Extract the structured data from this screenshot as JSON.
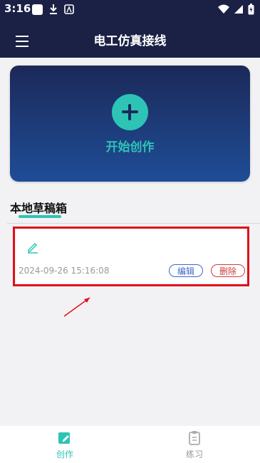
{
  "status": {
    "time": "3:16"
  },
  "appbar": {
    "title": "电工仿真接线"
  },
  "hero": {
    "label": "开始创作"
  },
  "drafts": {
    "title": "本地草稿箱",
    "items": [
      {
        "date": "2024-09-26 15:16:08",
        "edit_label": "编辑",
        "delete_label": "删除"
      }
    ]
  },
  "bottom_nav": {
    "items": [
      {
        "label": "创作",
        "icon": "edit-square-icon",
        "active": true
      },
      {
        "label": "练习",
        "icon": "clipboard-icon",
        "active": false
      }
    ]
  },
  "colors": {
    "header": "#1b2145",
    "accent": "#2dc4b5",
    "edit": "#3d66c6",
    "delete": "#d03b3b",
    "highlight": "#e0101a"
  }
}
